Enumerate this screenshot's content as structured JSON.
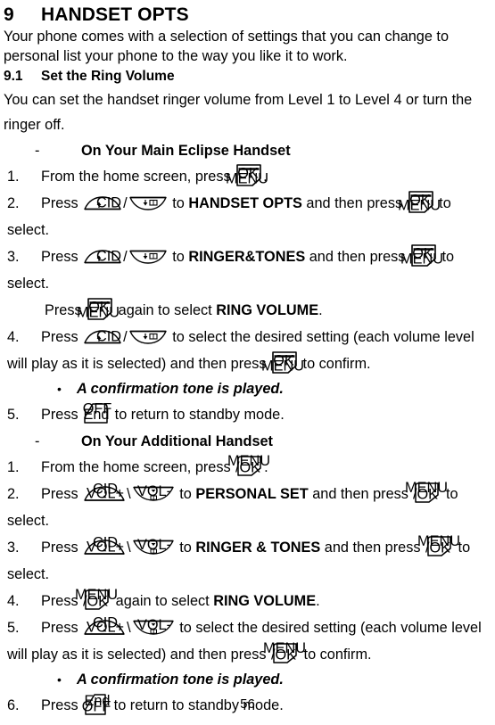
{
  "document": {
    "chapter_number": "9",
    "chapter_title": "HANDSET OPTS",
    "intro": "Your phone comes with a selection of settings that you can change to personal list your phone to the way you like it to work.",
    "section_number": "9.1",
    "section_title": "Set the Ring Volume",
    "section_intro": "You can set the handset ringer volume from Level 1 to Level 4 or turn the ringer off.",
    "page_number": "56"
  },
  "main_handset": {
    "dash": "-",
    "heading": "On Your Main Eclipse Handset",
    "steps": [
      {
        "number": "1.",
        "t1": "From the home screen, press ",
        "icons": [
          "ok-menu"
        ],
        "t2": "."
      },
      {
        "number": "2.",
        "t1": "Press ",
        "icons": [
          "up-cid",
          "down-phonebook"
        ],
        "sep": "/",
        "t2": " to ",
        "bold": "HANDSET OPTS",
        "t3": " and then press ",
        "icons2": [
          "ok-menu"
        ],
        "t4": " to select."
      },
      {
        "number": "3.",
        "t1": "Press ",
        "icons": [
          "up-cid",
          "down-phonebook"
        ],
        "sep": "/",
        "t2": " to ",
        "bold": "RINGER&TONES",
        "t3": " and then press ",
        "icons2": [
          "ok-menu"
        ],
        "t4": " to select.",
        "cont_t1": "Press ",
        "cont_icons": [
          "ok-menu"
        ],
        "cont_t2": " again to select ",
        "cont_bold": "RING VOLUME",
        "cont_t3": "."
      },
      {
        "number": "4.",
        "t1": "Press ",
        "icons": [
          "up-cid",
          "down-phonebook"
        ],
        "sep": "/",
        "t2": " to select the desired setting (each volume level will play as it is selected) and then press ",
        "icons2": [
          "ok-menu"
        ],
        "t3": " to confirm."
      },
      {
        "number": "5.",
        "t1": "Press ",
        "icons": [
          "off-end"
        ],
        "t2": " to return to standby mode."
      }
    ],
    "note": "A confirmation tone is played.",
    "note_bullet": "•"
  },
  "additional_handset": {
    "dash": "-",
    "heading": "On Your Additional Handset",
    "steps": [
      {
        "number": "1.",
        "t1": "From the home screen, press ",
        "icons": [
          "menu-ok"
        ],
        "t2": "."
      },
      {
        "number": "2.",
        "t1": "Press ",
        "icons": [
          "up-cid-vol",
          "down-vol"
        ],
        "sep": "\\",
        "t2": " to ",
        "bold": "PERSONAL SET",
        "t3": " and then press ",
        "icons2": [
          "menu-ok"
        ],
        "t4": " to select."
      },
      {
        "number": "3.",
        "t1": "Press ",
        "icons": [
          "up-cid-vol",
          "down-vol"
        ],
        "sep": "\\",
        "t2": " to ",
        "bold": "RINGER & TONES",
        "t3": " and then press ",
        "icons2": [
          "menu-ok"
        ],
        "t4": " to select."
      },
      {
        "number": "4.",
        "t1": "Press ",
        "icons": [
          "menu-ok"
        ],
        "t2": " again to select ",
        "bold": "RING VOLUME",
        "t3": "."
      },
      {
        "number": "5.",
        "t1": "Press ",
        "icons": [
          "up-cid-vol",
          "down-vol"
        ],
        "sep": "\\",
        "t2": " to select the desired setting (each volume level will play as it is selected) and then press ",
        "icons2": [
          "menu-ok"
        ],
        "t3": " to confirm."
      },
      {
        "number": "6.",
        "t1": "Press ",
        "icons": [
          "end-off"
        ],
        "t2": " to return to standby mode."
      }
    ],
    "note": "A confirmation tone is played.",
    "note_bullet": "•"
  },
  "key_labels": {
    "ok": "OK",
    "menu": "MENU",
    "menu_slash_ok_top": "MENU",
    "menu_slash_ok_bottom": "/OK",
    "off": "OFF",
    "end": "End",
    "cid": "CID",
    "vol_plus": "VOL+",
    "vol_minus": "VOL-"
  },
  "colors": {
    "ink": "#000000",
    "paper": "#ffffff"
  }
}
